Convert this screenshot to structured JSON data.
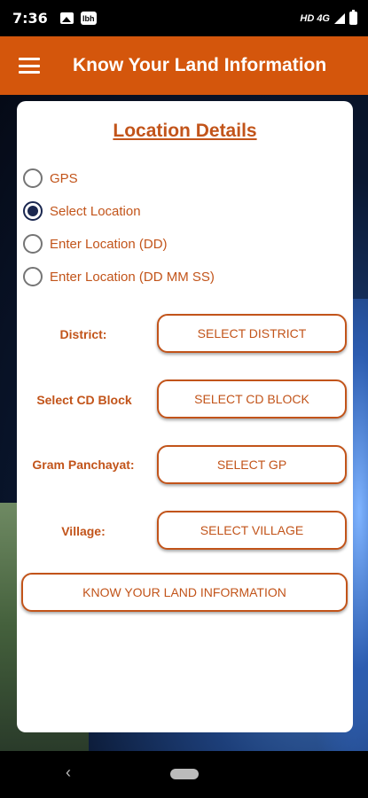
{
  "status_bar": {
    "time": "7:36",
    "app_badge": "lbh",
    "network": "HD 4G"
  },
  "app_bar": {
    "title": "Know Your Land Information",
    "menu_icon": "hamburger-menu-icon"
  },
  "card": {
    "title": "Location Details",
    "radio_options": [
      {
        "label": "GPS",
        "selected": false
      },
      {
        "label": "Select Location",
        "selected": true
      },
      {
        "label": "Enter Location (DD)",
        "selected": false
      },
      {
        "label": "Enter Location (DD MM SS)",
        "selected": false
      }
    ],
    "fields": [
      {
        "label": "District:",
        "button": "SELECT DISTRICT"
      },
      {
        "label": "Select CD Block",
        "button": "SELECT CD BLOCK"
      },
      {
        "label": "Gram Panchayat:",
        "button": "SELECT GP"
      },
      {
        "label": "Village:",
        "button": "SELECT VILLAGE"
      }
    ],
    "submit_button": "KNOW YOUR LAND INFORMATION"
  },
  "nav_bar": {
    "back_glyph": "‹"
  },
  "colors": {
    "accent": "#d4560c",
    "text_accent": "#c2541a",
    "radio_selected": "#1a2750"
  }
}
